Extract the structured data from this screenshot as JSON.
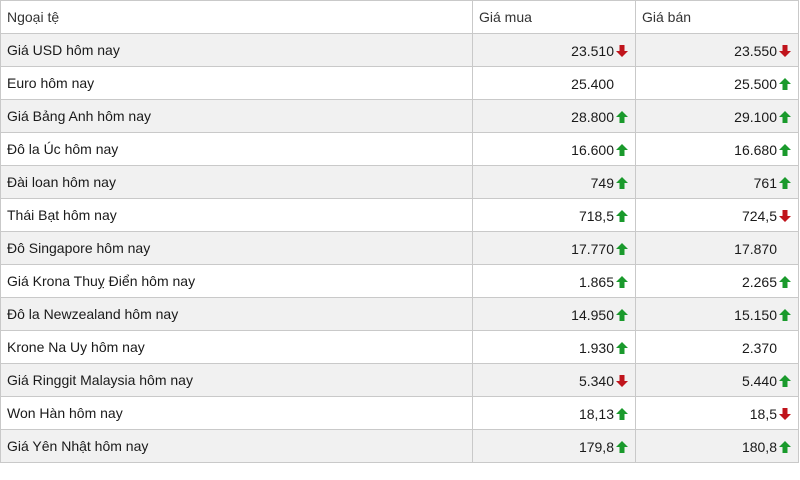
{
  "header": {
    "currency": "Ngoại tệ",
    "buy": "Giá mua",
    "sell": "Giá bán"
  },
  "colors": {
    "up": "#1a9a2c",
    "down": "#c0141c"
  },
  "rows": [
    {
      "name": "Giá USD hôm nay",
      "buy": "23.510",
      "buy_trend": "down",
      "sell": "23.550",
      "sell_trend": "down"
    },
    {
      "name": "Euro hôm nay",
      "buy": "25.400",
      "buy_trend": "none",
      "sell": "25.500",
      "sell_trend": "up"
    },
    {
      "name": "Giá Bảng Anh hôm nay",
      "buy": "28.800",
      "buy_trend": "up",
      "sell": "29.100",
      "sell_trend": "up"
    },
    {
      "name": "Đô la Úc hôm nay",
      "buy": "16.600",
      "buy_trend": "up",
      "sell": "16.680",
      "sell_trend": "up"
    },
    {
      "name": "Đài loan hôm nay",
      "buy": "749",
      "buy_trend": "up",
      "sell": "761",
      "sell_trend": "up"
    },
    {
      "name": "Thái Bạt hôm nay",
      "buy": "718,5",
      "buy_trend": "up",
      "sell": "724,5",
      "sell_trend": "down"
    },
    {
      "name": "Đô Singapore hôm nay",
      "buy": "17.770",
      "buy_trend": "up",
      "sell": "17.870",
      "sell_trend": "none"
    },
    {
      "name": "Giá Krona Thuỵ Điển hôm nay",
      "buy": "1.865",
      "buy_trend": "up",
      "sell": "2.265",
      "sell_trend": "up"
    },
    {
      "name": "Đô la Newzealand hôm nay",
      "buy": "14.950",
      "buy_trend": "up",
      "sell": "15.150",
      "sell_trend": "up"
    },
    {
      "name": "Krone Na Uy hôm nay",
      "buy": "1.930",
      "buy_trend": "up",
      "sell": "2.370",
      "sell_trend": "none"
    },
    {
      "name": "Giá Ringgit Malaysia hôm nay",
      "buy": "5.340",
      "buy_trend": "down",
      "sell": "5.440",
      "sell_trend": "up"
    },
    {
      "name": "Won Hàn hôm nay",
      "buy": "18,13",
      "buy_trend": "up",
      "sell": "18,5",
      "sell_trend": "down"
    },
    {
      "name": "Giá Yên Nhật hôm nay",
      "buy": "179,8",
      "buy_trend": "up",
      "sell": "180,8",
      "sell_trend": "up"
    }
  ]
}
